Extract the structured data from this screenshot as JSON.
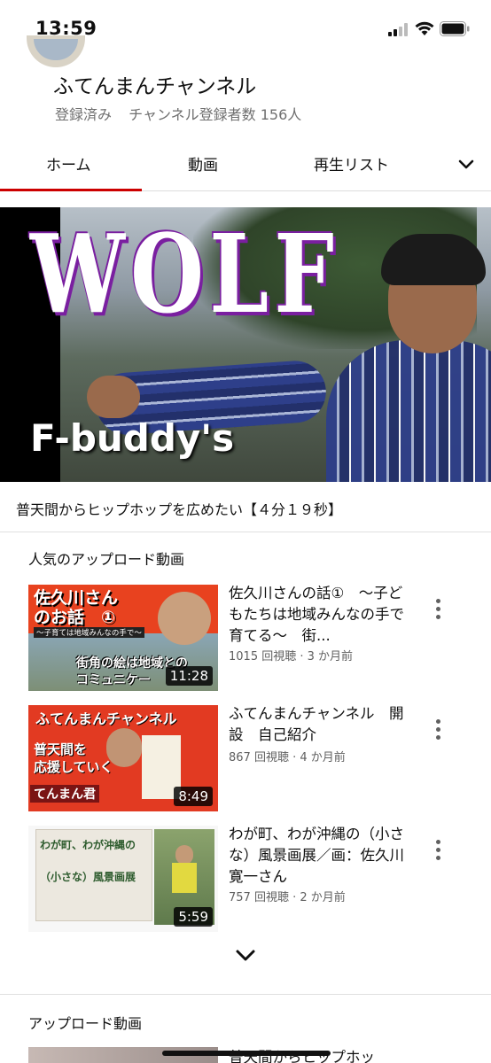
{
  "status_bar": {
    "time": "13:59"
  },
  "channel": {
    "name": "ふてんまんチャンネル",
    "subscribed_label": "登録済み",
    "subscriber_count": "チャンネル登録者数 156人"
  },
  "tabs": [
    {
      "label": "ホーム",
      "active": true
    },
    {
      "label": "動画",
      "active": false
    },
    {
      "label": "再生リスト",
      "active": false
    }
  ],
  "hero": {
    "wolf_text": "WOLF",
    "artist_text": "F-buddy's",
    "caption": "普天間からヒップホップを広めたい【４分１９秒】"
  },
  "popular": {
    "title": "人気のアップロード動画",
    "videos": [
      {
        "title": "佐久川さんの話①　〜子どもたちは地域みんなの手で育てる〜　街...",
        "meta": "1015 回視聴 · 3 か月前",
        "duration": "11:28",
        "thumb_text_1": "佐久川さん",
        "thumb_text_2": "のお話　①",
        "thumb_text_3": "〜子育ては地域みんなの手で〜",
        "thumb_text_4": "街角の絵は地域との",
        "thumb_text_5": "コミュニケー"
      },
      {
        "title": "ふてんまんチャンネル　開設　自己紹介",
        "meta": "867 回視聴 · 4 か月前",
        "duration": "8:49",
        "thumb_text_1": "ふてんまんチャンネル",
        "thumb_text_2": "普天間を",
        "thumb_text_3": "応援していく",
        "thumb_text_4": "てんまん君"
      },
      {
        "title": "わが町、わが沖縄の（小さな）風景画展／画：佐久川寛一さん",
        "meta": "757 回視聴 · 2 か月前",
        "duration": "5:59",
        "thumb_text_1": "わが町、わが沖縄の",
        "thumb_text_2": "（小さな）風景画展"
      }
    ]
  },
  "uploads": {
    "title": "アップロード動画",
    "first_title": "普天間からヒップホッ"
  },
  "colors": {
    "accent": "#cc0000",
    "meta_text": "#606060",
    "thumb_red": "#e23a22"
  }
}
